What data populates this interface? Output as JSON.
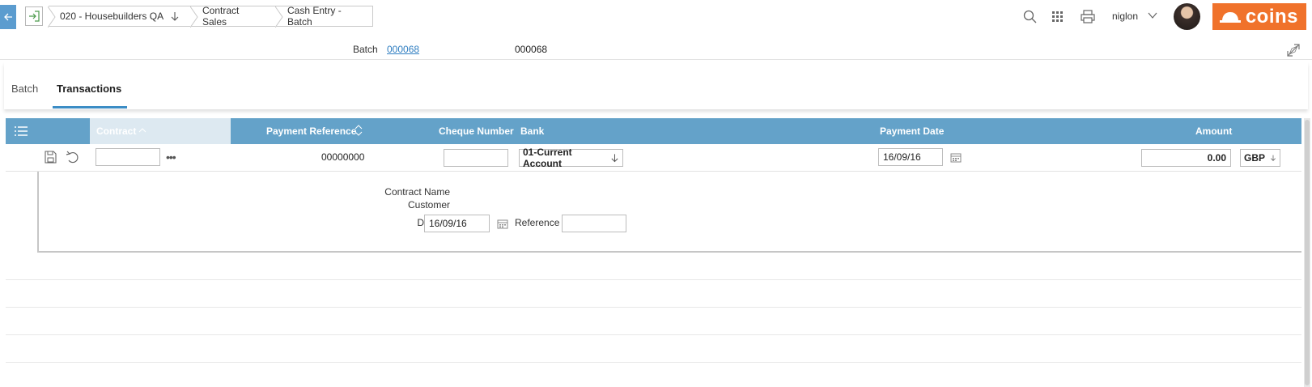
{
  "header": {
    "breadcrumbs": [
      {
        "label": "020 - Housebuilders QA"
      },
      {
        "label": "Contract Sales"
      },
      {
        "label": "Cash Entry - Batch"
      }
    ],
    "user": "niglon",
    "logo_text": "coins",
    "brand_color": "#f0722b",
    "accent_color": "#64a2c9"
  },
  "batch": {
    "label": "Batch",
    "link": "000068",
    "value": "000068"
  },
  "tabs": [
    {
      "label": "Batch",
      "active": false
    },
    {
      "label": "Transactions",
      "active": true
    }
  ],
  "grid": {
    "columns": {
      "contract": "Contract",
      "payment_reference": "Payment Reference",
      "cheque_number": "Cheque Number",
      "bank": "Bank",
      "payment_date": "Payment Date",
      "amount": "Amount"
    },
    "row": {
      "contract": "",
      "payment_reference": "00000000",
      "cheque_number": "",
      "bank": "01-Current Account",
      "payment_date": "16/09/16",
      "amount": "0.00",
      "currency": "GBP"
    }
  },
  "detail": {
    "contract_name_label": "Contract Name",
    "customer_label": "Customer",
    "deposit_label": "Deposit",
    "deposit_value": "16/09/16",
    "reference_label": "Reference",
    "reference_value": ""
  },
  "icons": [
    "back-arrow-icon",
    "exit-icon",
    "search-icon",
    "apps-grid-icon",
    "print-icon",
    "chevron-down-icon",
    "expand-icon",
    "menu-icon",
    "sort-icon",
    "save-icon",
    "undo-icon",
    "ellipsis-icon",
    "calendar-icon"
  ]
}
